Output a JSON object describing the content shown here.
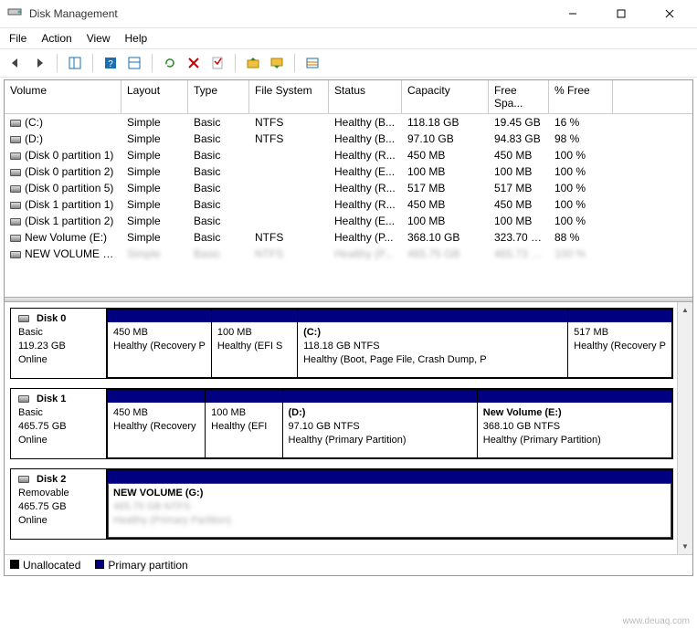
{
  "window": {
    "title": "Disk Management"
  },
  "menu": {
    "file": "File",
    "action": "Action",
    "view": "View",
    "help": "Help"
  },
  "columns": {
    "volume": "Volume",
    "layout": "Layout",
    "type": "Type",
    "fs": "File System",
    "status": "Status",
    "capacity": "Capacity",
    "free": "Free Spa...",
    "pct": "% Free"
  },
  "volumes": [
    {
      "name": "(C:)",
      "layout": "Simple",
      "type": "Basic",
      "fs": "NTFS",
      "status": "Healthy (B...",
      "capacity": "118.18 GB",
      "free": "19.45 GB",
      "pct": "16 %"
    },
    {
      "name": "(D:)",
      "layout": "Simple",
      "type": "Basic",
      "fs": "NTFS",
      "status": "Healthy (B...",
      "capacity": "97.10 GB",
      "free": "94.83 GB",
      "pct": "98 %"
    },
    {
      "name": "(Disk 0 partition 1)",
      "layout": "Simple",
      "type": "Basic",
      "fs": "",
      "status": "Healthy (R...",
      "capacity": "450 MB",
      "free": "450 MB",
      "pct": "100 %"
    },
    {
      "name": "(Disk 0 partition 2)",
      "layout": "Simple",
      "type": "Basic",
      "fs": "",
      "status": "Healthy (E...",
      "capacity": "100 MB",
      "free": "100 MB",
      "pct": "100 %"
    },
    {
      "name": "(Disk 0 partition 5)",
      "layout": "Simple",
      "type": "Basic",
      "fs": "",
      "status": "Healthy (R...",
      "capacity": "517 MB",
      "free": "517 MB",
      "pct": "100 %"
    },
    {
      "name": "(Disk 1 partition 1)",
      "layout": "Simple",
      "type": "Basic",
      "fs": "",
      "status": "Healthy (R...",
      "capacity": "450 MB",
      "free": "450 MB",
      "pct": "100 %"
    },
    {
      "name": "(Disk 1 partition 2)",
      "layout": "Simple",
      "type": "Basic",
      "fs": "",
      "status": "Healthy (E...",
      "capacity": "100 MB",
      "free": "100 MB",
      "pct": "100 %"
    },
    {
      "name": "New Volume (E:)",
      "layout": "Simple",
      "type": "Basic",
      "fs": "NTFS",
      "status": "Healthy (P...",
      "capacity": "368.10 GB",
      "free": "323.70 GB",
      "pct": "88 %"
    },
    {
      "name": "NEW VOLUME (G:)",
      "ghost": true,
      "layout": "Simple",
      "type": "Basic",
      "fs": "NTFS",
      "status": "Healthy (P...",
      "capacity": "465.75 GB",
      "free": "465.73 GB",
      "pct": "100 %"
    }
  ],
  "disks": [
    {
      "name": "Disk 0",
      "type": "Basic",
      "capacity": "119.23 GB",
      "status": "Online",
      "parts": [
        {
          "flex": 14,
          "line1": "",
          "line2": "450 MB",
          "line3": "Healthy (Recovery P"
        },
        {
          "flex": 12,
          "line1": "",
          "line2": "100 MB",
          "line3": "Healthy (EFI S"
        },
        {
          "flex": 38,
          "line1": "(C:)",
          "line2": "118.18 GB NTFS",
          "line3": "Healthy (Boot, Page File, Crash Dump, P"
        },
        {
          "flex": 14,
          "line1": "",
          "line2": "517 MB",
          "line3": "Healthy (Recovery P"
        }
      ]
    },
    {
      "name": "Disk 1",
      "type": "Basic",
      "capacity": "465.75 GB",
      "status": "Online",
      "parts": [
        {
          "flex": 14,
          "line1": "",
          "line2": "450 MB",
          "line3": "Healthy (Recovery"
        },
        {
          "flex": 11,
          "line1": "",
          "line2": "100 MB",
          "line3": "Healthy (EFI"
        },
        {
          "flex": 28,
          "line1": "(D:)",
          "line2": "97.10 GB NTFS",
          "line3": "Healthy (Primary Partition)"
        },
        {
          "flex": 28,
          "line1": "New Volume  (E:)",
          "line2": "368.10 GB NTFS",
          "line3": "Healthy (Primary Partition)"
        }
      ]
    },
    {
      "name": "Disk 2",
      "type": "Removable",
      "capacity": "465.75 GB",
      "status": "Online",
      "parts": [
        {
          "flex": 80,
          "line1": "NEW VOLUME  (G:)",
          "line2ghost": "465.75 GB NTFS",
          "line3ghost": "Healthy (Primary Partition)",
          "highlight": true
        }
      ]
    }
  ],
  "legend": {
    "unallocated": "Unallocated",
    "primary": "Primary partition"
  },
  "watermark": "www.deuaq.com"
}
